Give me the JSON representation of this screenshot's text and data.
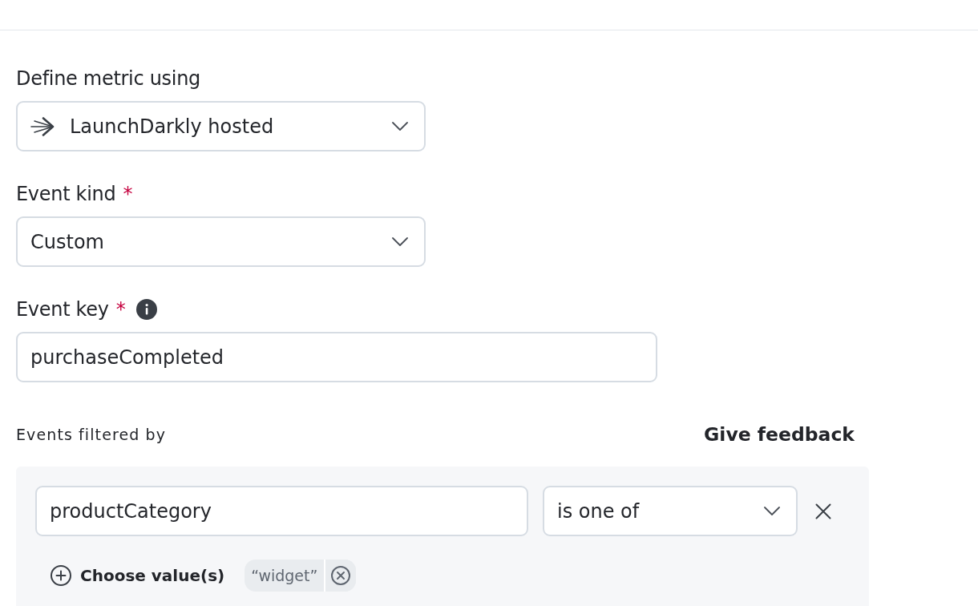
{
  "metric_source": {
    "label": "Define metric using",
    "value": "LaunchDarkly hosted"
  },
  "event_kind": {
    "label": "Event kind",
    "required_mark": "*",
    "value": "Custom"
  },
  "event_key": {
    "label": "Event key",
    "required_mark": "*",
    "value": "purchaseCompleted"
  },
  "filters": {
    "label": "Events filtered by",
    "feedback_link": "Give feedback",
    "rows": [
      {
        "property": "productCategory",
        "operator": "is one of",
        "choose_values_button": "Choose value(s)",
        "values": [
          "“widget”"
        ]
      }
    ]
  }
}
